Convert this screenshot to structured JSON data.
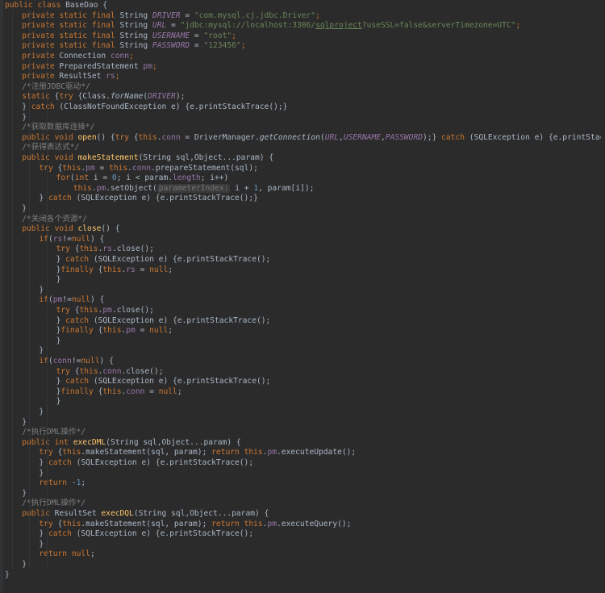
{
  "editor": {
    "colors": {
      "background": "#2b2b2b",
      "text": "#a9b7c6",
      "keyword": "#cc7832",
      "string": "#6a8759",
      "number": "#6897bb",
      "field": "#9876aa",
      "method_declaration": "#ffc66d",
      "comment": "#808080",
      "hint_background": "#3b3b3b"
    },
    "lines": [
      {
        "indent": 0,
        "tokens": [
          [
            "public class ",
            "k"
          ],
          [
            "BaseDao {",
            ""
          ]
        ]
      },
      {
        "indent": 1,
        "tokens": [
          [
            "private static final ",
            "k"
          ],
          [
            "String ",
            ""
          ],
          [
            "DRIVER",
            "fi"
          ],
          [
            " = ",
            ""
          ],
          [
            "\"com.mysql.cj.jdbc.Driver\"",
            "s"
          ],
          [
            ";",
            "k"
          ]
        ]
      },
      {
        "indent": 1,
        "tokens": [
          [
            "private static final ",
            "k"
          ],
          [
            "String ",
            ""
          ],
          [
            "URL",
            "fi"
          ],
          [
            " = ",
            ""
          ],
          [
            "\"jdbc:mysql://localhost:3306/",
            "s"
          ],
          [
            "sqlproject",
            "su"
          ],
          [
            "?useSSL=false&serverTimezone=UTC\"",
            "s"
          ],
          [
            ";",
            "k"
          ]
        ]
      },
      {
        "indent": 1,
        "tokens": [
          [
            "private static final ",
            "k"
          ],
          [
            "String ",
            ""
          ],
          [
            "USERNAME",
            "fi"
          ],
          [
            " = ",
            ""
          ],
          [
            "\"root\"",
            "s"
          ],
          [
            ";",
            "k"
          ]
        ]
      },
      {
        "indent": 1,
        "tokens": [
          [
            "private static final ",
            "k"
          ],
          [
            "String ",
            ""
          ],
          [
            "PASSWORD",
            "fi"
          ],
          [
            " = ",
            ""
          ],
          [
            "\"123456\"",
            "s"
          ],
          [
            ";",
            "k"
          ]
        ]
      },
      {
        "indent": 1,
        "tokens": [
          [
            "private ",
            "k"
          ],
          [
            "Connection ",
            ""
          ],
          [
            "conn",
            "f"
          ],
          [
            ";",
            "k"
          ]
        ]
      },
      {
        "indent": 1,
        "tokens": [
          [
            "private ",
            "k"
          ],
          [
            "PreparedStatement ",
            ""
          ],
          [
            "pm",
            "f"
          ],
          [
            ";",
            "k"
          ]
        ]
      },
      {
        "indent": 1,
        "tokens": [
          [
            "private ",
            "k"
          ],
          [
            "ResultSet ",
            ""
          ],
          [
            "rs",
            "f"
          ],
          [
            ";",
            "k"
          ]
        ]
      },
      {
        "indent": 1,
        "tokens": [
          [
            "/*注册JDBC驱动*/",
            "c"
          ]
        ]
      },
      {
        "indent": 1,
        "tokens": [
          [
            "static ",
            "k"
          ],
          [
            "{",
            ""
          ],
          [
            "try ",
            "k"
          ],
          [
            "{Class.",
            ""
          ],
          [
            "forName",
            "mi"
          ],
          [
            "(",
            ""
          ],
          [
            "DRIVER",
            "fi"
          ],
          [
            ");",
            ""
          ]
        ]
      },
      {
        "indent": 1,
        "tokens": [
          [
            "} ",
            ""
          ],
          [
            "catch ",
            "k"
          ],
          [
            "(ClassNotFoundException e) {e.printStackTrace();}",
            ""
          ]
        ]
      },
      {
        "indent": 1,
        "tokens": [
          [
            "}",
            ""
          ]
        ]
      },
      {
        "indent": 1,
        "tokens": [
          [
            "/*获取数据库连接*/",
            "c"
          ]
        ]
      },
      {
        "indent": 1,
        "tokens": [
          [
            "public void ",
            "k"
          ],
          [
            "open",
            "m"
          ],
          [
            "() {",
            ""
          ],
          [
            "try ",
            "k"
          ],
          [
            "{",
            ""
          ],
          [
            "this",
            "k"
          ],
          [
            ".",
            ""
          ],
          [
            "conn",
            "f"
          ],
          [
            " = DriverManager.",
            ""
          ],
          [
            "getConnection",
            "mi"
          ],
          [
            "(",
            ""
          ],
          [
            "URL",
            "fi"
          ],
          [
            ",",
            ""
          ],
          [
            "USERNAME",
            "fi"
          ],
          [
            ",",
            ""
          ],
          [
            "PASSWORD",
            "fi"
          ],
          [
            ");} ",
            ""
          ],
          [
            "catch ",
            "k"
          ],
          [
            "(SQLException e) {e.printStackTrace();}",
            ""
          ]
        ]
      },
      {
        "indent": 1,
        "tokens": [
          [
            "/*获得表达式*/",
            "c"
          ]
        ]
      },
      {
        "indent": 1,
        "tokens": [
          [
            "public void ",
            "k"
          ],
          [
            "makeStatement",
            "m"
          ],
          [
            "(String sql,Object...param) {",
            ""
          ]
        ]
      },
      {
        "indent": 2,
        "tokens": [
          [
            "try ",
            "k"
          ],
          [
            "{",
            ""
          ],
          [
            "this",
            "k"
          ],
          [
            ".",
            ""
          ],
          [
            "pm",
            "f"
          ],
          [
            " = ",
            ""
          ],
          [
            "this",
            "k"
          ],
          [
            ".",
            ""
          ],
          [
            "conn",
            "f"
          ],
          [
            ".prepareStatement(sql);",
            ""
          ]
        ]
      },
      {
        "indent": 3,
        "tokens": [
          [
            "for",
            "k"
          ],
          [
            "(",
            ""
          ],
          [
            "int ",
            "k"
          ],
          [
            "i = ",
            ""
          ],
          [
            "0",
            "n"
          ],
          [
            "; i < param.",
            ""
          ],
          [
            "length",
            "f"
          ],
          [
            "; i++)",
            ""
          ]
        ]
      },
      {
        "indent": 4,
        "tokens": [
          [
            "this",
            "k"
          ],
          [
            ".",
            ""
          ],
          [
            "pm",
            "f"
          ],
          [
            ".setObject(",
            ""
          ],
          [
            "parameterIndex:",
            "h"
          ],
          [
            " i + ",
            ""
          ],
          [
            "1",
            "n"
          ],
          [
            ", param[i]);",
            ""
          ]
        ]
      },
      {
        "indent": 2,
        "tokens": [
          [
            "} ",
            ""
          ],
          [
            "catch ",
            "k"
          ],
          [
            "(SQLException e) {e.printStackTrace();}",
            ""
          ]
        ]
      },
      {
        "indent": 1,
        "tokens": [
          [
            "}",
            ""
          ]
        ]
      },
      {
        "indent": 1,
        "tokens": [
          [
            "/*关闭各个资源*/",
            "c"
          ]
        ]
      },
      {
        "indent": 1,
        "tokens": [
          [
            "public void ",
            "k"
          ],
          [
            "close",
            "m"
          ],
          [
            "() {",
            ""
          ]
        ]
      },
      {
        "indent": 2,
        "tokens": [
          [
            "if",
            "k"
          ],
          [
            "(",
            ""
          ],
          [
            "rs",
            "f"
          ],
          [
            "!=",
            ""
          ],
          [
            "null",
            "k"
          ],
          [
            ") {",
            ""
          ]
        ]
      },
      {
        "indent": 3,
        "tokens": [
          [
            "try ",
            "k"
          ],
          [
            "{",
            ""
          ],
          [
            "this",
            "k"
          ],
          [
            ".",
            ""
          ],
          [
            "rs",
            "f"
          ],
          [
            ".close();",
            ""
          ]
        ]
      },
      {
        "indent": 3,
        "tokens": [
          [
            "} ",
            ""
          ],
          [
            "catch ",
            "k"
          ],
          [
            "(SQLException e) {e.printStackTrace();",
            ""
          ]
        ]
      },
      {
        "indent": 3,
        "tokens": [
          [
            "}",
            ""
          ],
          [
            "finally ",
            "k"
          ],
          [
            "{",
            ""
          ],
          [
            "this",
            "k"
          ],
          [
            ".",
            ""
          ],
          [
            "rs",
            "f"
          ],
          [
            " = ",
            ""
          ],
          [
            "null",
            "k"
          ],
          [
            ";",
            ""
          ]
        ]
      },
      {
        "indent": 3,
        "tokens": [
          [
            "}",
            ""
          ]
        ]
      },
      {
        "indent": 2,
        "tokens": [
          [
            "}",
            ""
          ]
        ]
      },
      {
        "indent": 2,
        "tokens": [
          [
            "if",
            "k"
          ],
          [
            "(",
            ""
          ],
          [
            "pm",
            "f"
          ],
          [
            "!=",
            ""
          ],
          [
            "null",
            "k"
          ],
          [
            ") {",
            ""
          ]
        ]
      },
      {
        "indent": 3,
        "tokens": [
          [
            "try ",
            "k"
          ],
          [
            "{",
            ""
          ],
          [
            "this",
            "k"
          ],
          [
            ".",
            ""
          ],
          [
            "pm",
            "f"
          ],
          [
            ".close();",
            ""
          ]
        ]
      },
      {
        "indent": 3,
        "tokens": [
          [
            "} ",
            ""
          ],
          [
            "catch ",
            "k"
          ],
          [
            "(SQLException e) {e.printStackTrace();",
            ""
          ]
        ]
      },
      {
        "indent": 3,
        "tokens": [
          [
            "}",
            ""
          ],
          [
            "finally ",
            "k"
          ],
          [
            "{",
            ""
          ],
          [
            "this",
            "k"
          ],
          [
            ".",
            ""
          ],
          [
            "pm",
            "f"
          ],
          [
            " = ",
            ""
          ],
          [
            "null",
            "k"
          ],
          [
            ";",
            ""
          ]
        ]
      },
      {
        "indent": 3,
        "tokens": [
          [
            "}",
            ""
          ]
        ]
      },
      {
        "indent": 2,
        "tokens": [
          [
            "}",
            ""
          ]
        ]
      },
      {
        "indent": 2,
        "tokens": [
          [
            "if",
            "k"
          ],
          [
            "(",
            ""
          ],
          [
            "conn",
            "f"
          ],
          [
            "!=",
            ""
          ],
          [
            "null",
            "k"
          ],
          [
            ") {",
            ""
          ]
        ]
      },
      {
        "indent": 3,
        "tokens": [
          [
            "try ",
            "k"
          ],
          [
            "{",
            ""
          ],
          [
            "this",
            "k"
          ],
          [
            ".",
            ""
          ],
          [
            "conn",
            "f"
          ],
          [
            ".close();",
            ""
          ]
        ]
      },
      {
        "indent": 3,
        "tokens": [
          [
            "} ",
            ""
          ],
          [
            "catch ",
            "k"
          ],
          [
            "(SQLException e) {e.printStackTrace();",
            ""
          ]
        ]
      },
      {
        "indent": 3,
        "tokens": [
          [
            "}",
            ""
          ],
          [
            "finally ",
            "k"
          ],
          [
            "{",
            ""
          ],
          [
            "this",
            "k"
          ],
          [
            ".",
            ""
          ],
          [
            "conn",
            "f"
          ],
          [
            " = ",
            ""
          ],
          [
            "null",
            "k"
          ],
          [
            ";",
            ""
          ]
        ]
      },
      {
        "indent": 3,
        "tokens": [
          [
            "}",
            ""
          ]
        ]
      },
      {
        "indent": 2,
        "tokens": [
          [
            "}",
            ""
          ]
        ]
      },
      {
        "indent": 1,
        "tokens": [
          [
            "}",
            ""
          ]
        ]
      },
      {
        "indent": 1,
        "tokens": [
          [
            "/*执行DML操作*/",
            "c"
          ]
        ]
      },
      {
        "indent": 1,
        "tokens": [
          [
            "public int ",
            "k"
          ],
          [
            "execDML",
            "m"
          ],
          [
            "(String sql,Object...param) {",
            ""
          ]
        ]
      },
      {
        "indent": 2,
        "tokens": [
          [
            "try ",
            "k"
          ],
          [
            "{",
            ""
          ],
          [
            "this",
            "k"
          ],
          [
            ".makeStatement(sql, param); ",
            ""
          ],
          [
            "return this",
            "k"
          ],
          [
            ".",
            ""
          ],
          [
            "pm",
            "f"
          ],
          [
            ".executeUpdate();",
            ""
          ]
        ]
      },
      {
        "indent": 2,
        "tokens": [
          [
            "} ",
            ""
          ],
          [
            "catch ",
            "k"
          ],
          [
            "(SQLException e) {e.printStackTrace();",
            ""
          ]
        ]
      },
      {
        "indent": 2,
        "tokens": [
          [
            "}",
            ""
          ]
        ]
      },
      {
        "indent": 2,
        "tokens": [
          [
            "return ",
            "k"
          ],
          [
            "-",
            ""
          ],
          [
            "1",
            "n"
          ],
          [
            ";",
            ""
          ]
        ]
      },
      {
        "indent": 1,
        "tokens": [
          [
            "}",
            ""
          ]
        ]
      },
      {
        "indent": 1,
        "tokens": [
          [
            "/*执行DML操作*/",
            "c"
          ]
        ]
      },
      {
        "indent": 1,
        "tokens": [
          [
            "public ",
            "k"
          ],
          [
            "ResultSet ",
            ""
          ],
          [
            "execDQL",
            "m"
          ],
          [
            "(String sql,Object...param) {",
            ""
          ]
        ]
      },
      {
        "indent": 2,
        "tokens": [
          [
            "try ",
            "k"
          ],
          [
            "{",
            ""
          ],
          [
            "this",
            "k"
          ],
          [
            ".makeStatement(sql, param); ",
            ""
          ],
          [
            "return this",
            "k"
          ],
          [
            ".",
            ""
          ],
          [
            "pm",
            "f"
          ],
          [
            ".executeQuery();",
            ""
          ]
        ]
      },
      {
        "indent": 2,
        "tokens": [
          [
            "} ",
            ""
          ],
          [
            "catch ",
            "k"
          ],
          [
            "(SQLException e) {e.printStackTrace();",
            ""
          ]
        ]
      },
      {
        "indent": 2,
        "tokens": [
          [
            "}",
            ""
          ]
        ]
      },
      {
        "indent": 2,
        "tokens": [
          [
            "return null",
            "k"
          ],
          [
            ";",
            ""
          ]
        ]
      },
      {
        "indent": 1,
        "tokens": [
          [
            "}",
            ""
          ]
        ]
      },
      {
        "indent": 0,
        "tokens": [
          [
            "}",
            ""
          ]
        ]
      }
    ]
  }
}
